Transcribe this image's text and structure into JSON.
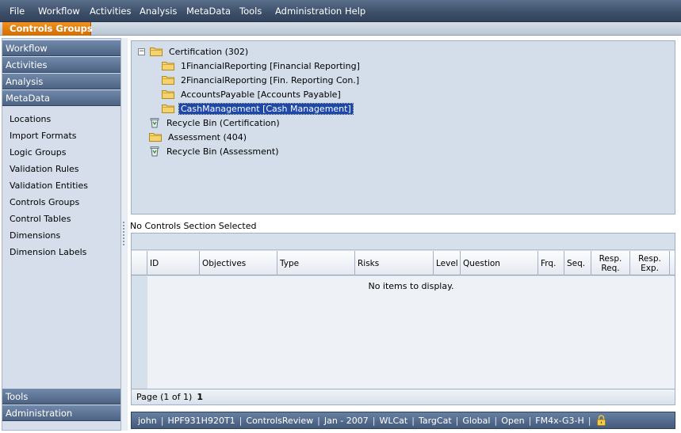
{
  "menu": [
    "File",
    "Workflow",
    "Activities",
    "Analysis",
    "MetaData",
    "Tools",
    "Administration",
    "Help"
  ],
  "active_tab": "Controls Groups",
  "sidebar": {
    "top_headers": [
      "Workflow",
      "Activities",
      "Analysis",
      "MetaData"
    ],
    "links": [
      "Locations",
      "Import Formats",
      "Logic Groups",
      "Validation Rules",
      "Validation Entities",
      "Controls Groups",
      "Control Tables",
      "Dimensions",
      "Dimension Labels"
    ],
    "bottom_headers": [
      "Tools",
      "Administration"
    ]
  },
  "tree": {
    "nodes": [
      {
        "label": "Certification (302)",
        "icon": "folder-icon",
        "toggle": "−",
        "depth": 0
      },
      {
        "label": "1FinancialReporting [Financial Reporting]",
        "icon": "folder-icon",
        "depth": 1
      },
      {
        "label": "2FinancialReporting [Fin. Reporting Con.]",
        "icon": "folder-icon",
        "depth": 1
      },
      {
        "label": "AccountsPayable [Accounts Payable]",
        "icon": "folder-icon",
        "depth": 1
      },
      {
        "label": "CashManagement [Cash Management]",
        "icon": "folder-icon",
        "depth": 1,
        "selected": true
      },
      {
        "label": "Recycle Bin (Certification)",
        "icon": "recycle-bin-icon",
        "depth": 0
      },
      {
        "label": "Assessment (404)",
        "icon": "folder-icon",
        "depth": 0
      },
      {
        "label": "Recycle Bin (Assessment)",
        "icon": "recycle-bin-icon",
        "depth": 0
      }
    ]
  },
  "section_status": "No Controls Section Selected",
  "grid": {
    "columns": [
      "ID",
      "Objectives",
      "Type",
      "Risks",
      "Level",
      "Question",
      "Frq.",
      "Seq.",
      "Resp. Req.",
      "Resp. Exp."
    ],
    "empty_message": "No items to display.",
    "pager_text": "Page (1 of 1)",
    "pager_current": "1"
  },
  "statusbar": [
    "john",
    "HPF931H920T1",
    "ControlsReview",
    "Jan - 2007",
    "WLCat",
    "TargCat",
    "Global",
    "Open",
    "FM4x-G3-H"
  ],
  "colors": {
    "accent_tab": "#e07a0a",
    "menubar": "#3c4e68",
    "selection": "#1d48a9"
  }
}
